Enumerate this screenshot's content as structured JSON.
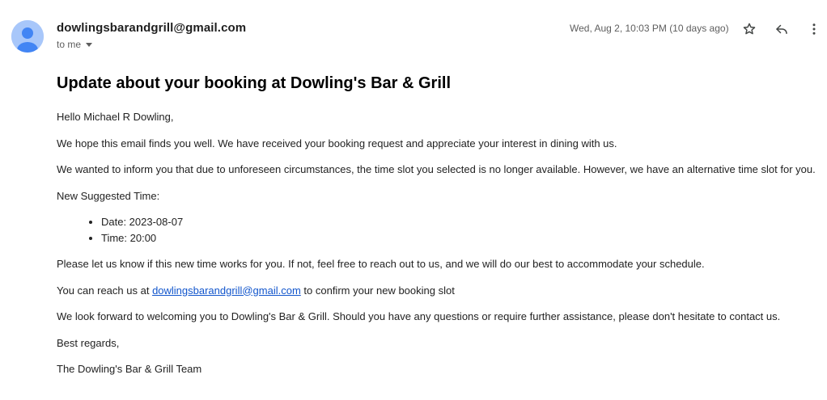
{
  "header": {
    "sender_email": "dowlingsbarandgrill@gmail.com",
    "recipient_label": "to me",
    "date": "Wed, Aug 2, 10:03 PM (10 days ago)"
  },
  "icons": {
    "avatar": "person-avatar-icon",
    "star": "star-outline-icon",
    "reply": "reply-icon",
    "more": "more-vertical-icon"
  },
  "colors": {
    "avatar_bg": "#a8c7fa",
    "avatar_fg": "#4285f4",
    "link": "#1155cc"
  },
  "email": {
    "subject": "Update about your booking at Dowling's Bar & Grill",
    "greeting": "Hello Michael R Dowling,",
    "para1": "We hope this email finds you well. We have received your booking request and appreciate your interest in dining with us.",
    "para2": "We wanted to inform you that due to unforeseen circumstances, the time slot you selected is no longer available. However, we have an alternative time slot for you.",
    "suggested_heading": "New Suggested Time:",
    "details": [
      {
        "text": "Date: 2023-08-07"
      },
      {
        "text": "Time: 20:00"
      }
    ],
    "para3": "Please let us know if this new time works for you. If not, feel free to reach out to us, and we will do our best to accommodate your schedule.",
    "contact_prefix": "You can reach us at ",
    "contact_link": "dowlingsbarandgrill@gmail.com",
    "contact_suffix": " to confirm your new booking slot",
    "para4": "We look forward to welcoming you to Dowling's Bar & Grill. Should you have any questions or require further assistance, please don't hesitate to contact us.",
    "closing": "Best regards,",
    "signature": "The Dowling's Bar & Grill Team"
  }
}
